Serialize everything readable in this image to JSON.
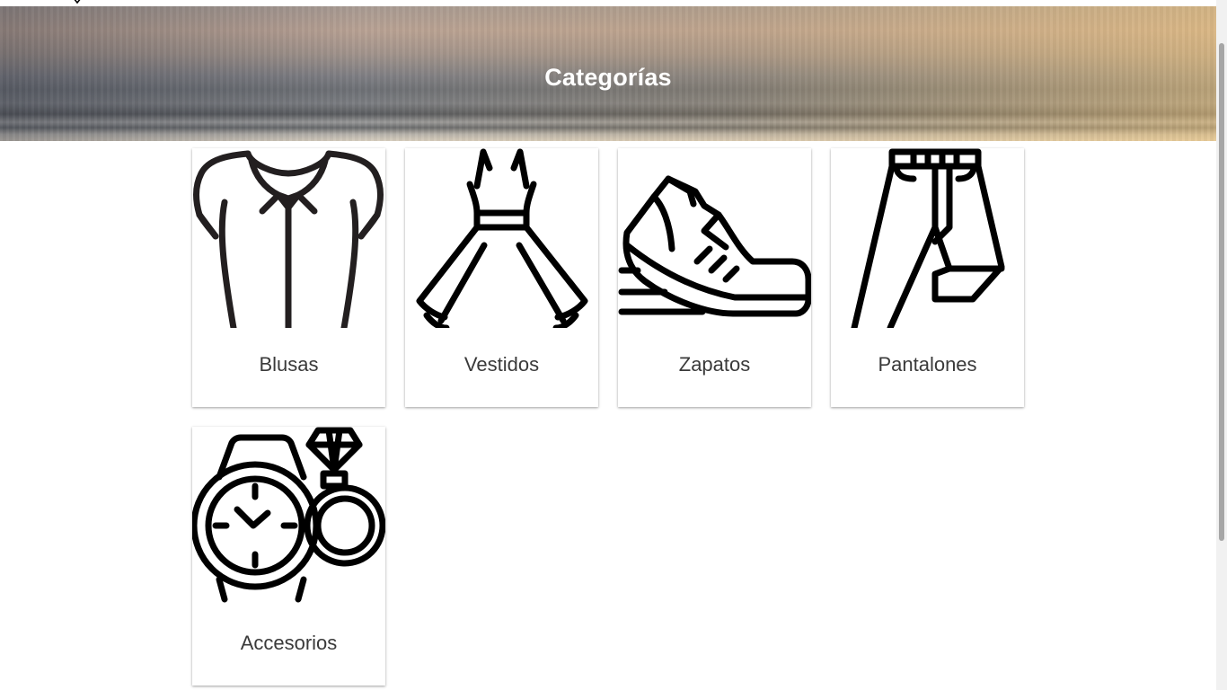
{
  "header": {
    "title": "Categorías"
  },
  "categories": [
    {
      "label": "Blusas",
      "icon": "blouse-icon"
    },
    {
      "label": "Vestidos",
      "icon": "dress-icon"
    },
    {
      "label": "Zapatos",
      "icon": "sneaker-icon"
    },
    {
      "label": "Pantalones",
      "icon": "pants-icon"
    },
    {
      "label": "Accesorios",
      "icon": "watch-ring-icon"
    }
  ],
  "colors": {
    "title_text": "#ffffff",
    "label_text": "#3a3a3a",
    "icon_stroke": "#000000",
    "card_background": "#ffffff",
    "banner_warm": "#f0c27a",
    "banner_cool": "#6e7176"
  }
}
